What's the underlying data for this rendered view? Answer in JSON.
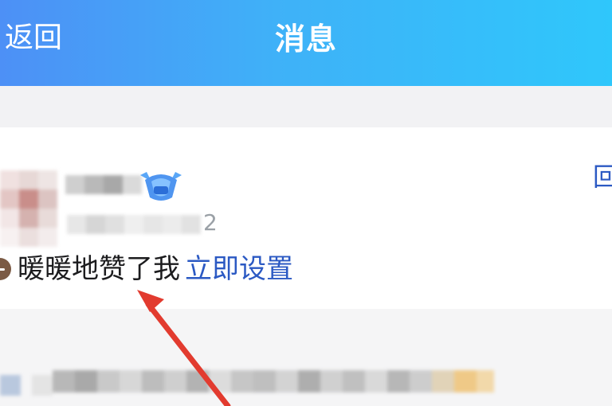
{
  "header": {
    "back_label": "返回",
    "title": "消息"
  },
  "card": {
    "meta_tail": "2",
    "notice_text": "暖暖地赞了我",
    "setup_link": "立即设置",
    "reply_snippet": "回"
  },
  "colors": {
    "header_gradient": [
      "#4d90f6",
      "#2fc7fb"
    ],
    "link": "#2b59c3",
    "text": "#1c1c1e",
    "annotation_arrow": "#e23b2f"
  }
}
